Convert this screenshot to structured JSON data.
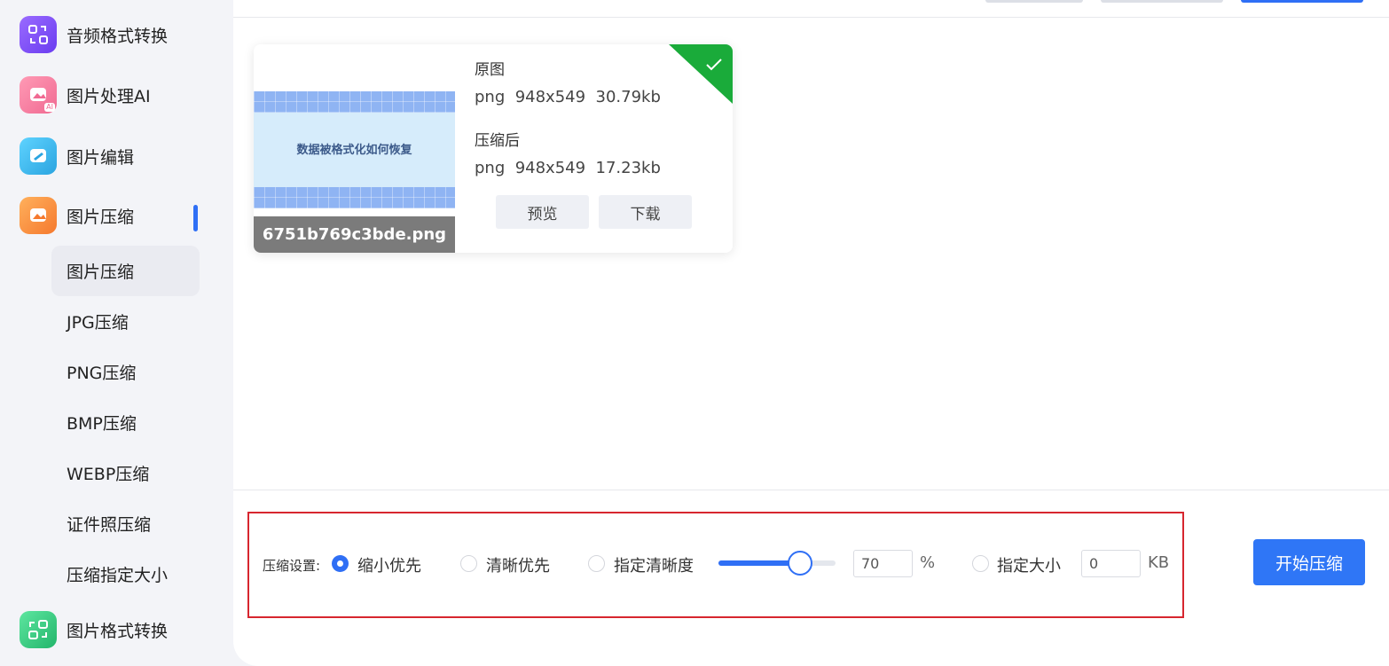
{
  "sidebar": {
    "items": [
      {
        "label": "音频格式转换",
        "icon": "audio-convert-icon",
        "color": "#7a4cf2"
      },
      {
        "label": "图片处理AI",
        "icon": "image-ai-icon",
        "color": "#f2749a"
      },
      {
        "label": "图片编辑",
        "icon": "image-edit-icon",
        "color": "#3db8e8"
      },
      {
        "label": "图片压缩",
        "icon": "image-compress-icon",
        "color": "#f58a3c"
      },
      {
        "label": "图片格式转换",
        "icon": "image-format-icon",
        "color": "#2cc27a"
      }
    ],
    "ai_badge": "AI",
    "sub_items": [
      {
        "label": "图片压缩",
        "active": true
      },
      {
        "label": "JPG压缩"
      },
      {
        "label": "PNG压缩"
      },
      {
        "label": "BMP压缩"
      },
      {
        "label": "WEBP压缩"
      },
      {
        "label": "证件照压缩"
      },
      {
        "label": "压缩指定大小"
      }
    ],
    "active_color": "#2f6ff5"
  },
  "result_card": {
    "thumbnail_text": "数据被格式化如何恢复",
    "filename": "6751b769c3bde.png",
    "original_label": "原图",
    "original_info": "png  948x549  30.79kb",
    "compressed_label": "压缩后",
    "compressed_info": "png  948x549  17.23kb",
    "preview_label": "预览",
    "download_label": "下载",
    "status_color": "#1aab3a"
  },
  "settings": {
    "label": "压缩设置:",
    "options": [
      {
        "label": "缩小优先",
        "checked": true
      },
      {
        "label": "清晰优先",
        "checked": false
      },
      {
        "label": "指定清晰度",
        "checked": false
      },
      {
        "label": "指定大小",
        "checked": false
      }
    ],
    "quality_value": "70",
    "quality_percent": 70,
    "quality_unit": "%",
    "size_value": "0",
    "size_unit": "KB",
    "start_label": "开始压缩",
    "highlight_color": "#d7262f",
    "accent_color": "#2f6ff5"
  }
}
